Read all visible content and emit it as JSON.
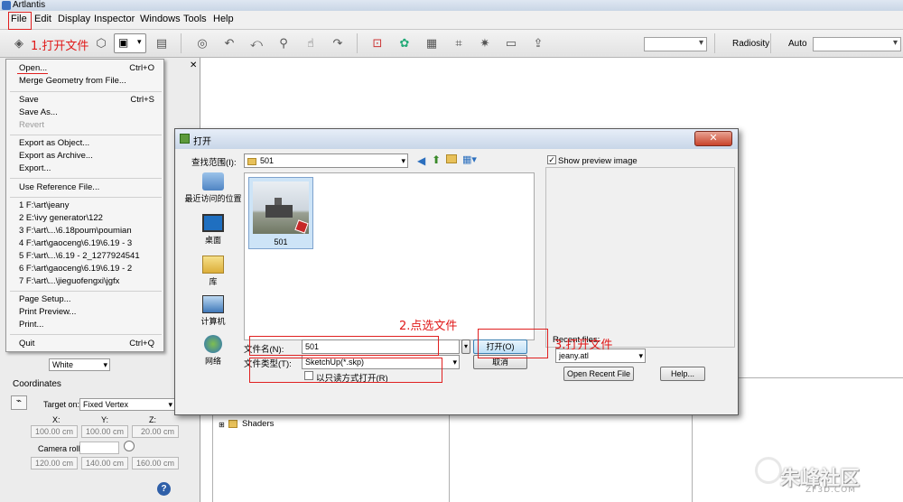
{
  "app": {
    "title": "Artlantis"
  },
  "menubar": {
    "items": [
      "File",
      "Edit",
      "Display",
      "Inspector",
      "Windows",
      "Tools",
      "Help"
    ]
  },
  "annotations": {
    "step1": "1.打开文件",
    "step2": "2.点选文件",
    "step3": "3.打开文件"
  },
  "toolbar": {
    "radiosity_label": "Radiosity",
    "auto_label": "Auto",
    "combo1_value": "",
    "combo2_value": ""
  },
  "file_menu": {
    "items": [
      {
        "label": "Open...",
        "shortcut": "Ctrl+O"
      },
      {
        "label": "Merge Geometry from File...",
        "shortcut": ""
      },
      {
        "label": "Save",
        "shortcut": "Ctrl+S"
      },
      {
        "label": "Save As...",
        "shortcut": ""
      },
      {
        "label": "Revert",
        "shortcut": ""
      },
      {
        "label": "Export as Object...",
        "shortcut": ""
      },
      {
        "label": "Export as Archive...",
        "shortcut": ""
      },
      {
        "label": "Export...",
        "shortcut": ""
      },
      {
        "label": "Use Reference File...",
        "shortcut": ""
      },
      {
        "label": "1 F:\\art\\jeany",
        "shortcut": ""
      },
      {
        "label": "2 E:\\ivy generator\\122",
        "shortcut": ""
      },
      {
        "label": "3 F:\\art\\...\\6.18poum\\poumian",
        "shortcut": ""
      },
      {
        "label": "4 F:\\art\\gaoceng\\6.19\\6.19 - 3",
        "shortcut": ""
      },
      {
        "label": "5 F:\\art\\...\\6.19 - 2_1277924541",
        "shortcut": ""
      },
      {
        "label": "6 F:\\art\\gaoceng\\6.19\\6.19 - 2",
        "shortcut": ""
      },
      {
        "label": "7 F:\\art\\...\\jieguofengxi\\jgfx",
        "shortcut": ""
      },
      {
        "label": "Page Setup...",
        "shortcut": ""
      },
      {
        "label": "Print Preview...",
        "shortcut": ""
      },
      {
        "label": "Print...",
        "shortcut": ""
      },
      {
        "label": "Quit",
        "shortcut": "Ctrl+Q"
      }
    ]
  },
  "left_panel": {
    "white_select": "White",
    "coordinates_title": "Coordinates",
    "target_on_label": "Target on:",
    "target_on_value": "Fixed Vertex",
    "x_label": "X:",
    "y_label": "Y:",
    "z_label": "Z:",
    "x_value": "100.00 cm",
    "y_value": "100.00 cm",
    "z_value": "20.00 cm",
    "camera_roll_label": "Camera roll:",
    "row2_x": "120.00 cm",
    "row2_y": "140.00 cm",
    "row2_z": "160.00 cm",
    "help_icon": "?"
  },
  "dialog": {
    "title": "打开",
    "close_label": "✕",
    "look_in_label": "查找范围(I):",
    "look_in_value": "501",
    "places": [
      "最近访问的位置",
      "桌面",
      "库",
      "计算机",
      "网络"
    ],
    "file_item": "501",
    "filename_label": "文件名(N):",
    "filename_value": "501",
    "filetype_label": "文件类型(T):",
    "filetype_value": "SketchUp(*.skp)",
    "readonly_label": "以只读方式打开(R)",
    "open_button": "打开(O)",
    "cancel_button": "取消",
    "show_preview_label": "Show preview image",
    "recent_files_label": "Recent files:",
    "recent_files_value": "jeany.atl",
    "open_recent_button": "Open Recent File",
    "help_button": "Help..."
  },
  "viewport": {
    "tree_item": "Shaders"
  },
  "watermark": {
    "text": "朱峰社区",
    "sub": "ZF3D.COM"
  }
}
